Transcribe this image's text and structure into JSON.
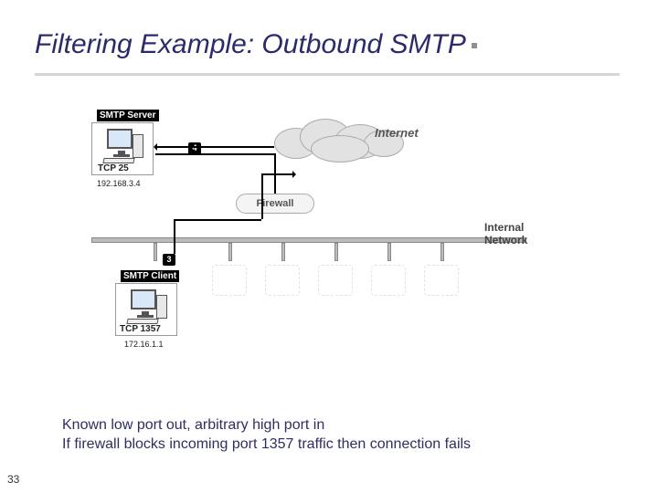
{
  "title": "Filtering Example: Outbound SMTP",
  "slide_number": "33",
  "caption_line1": "Known low port out, arbitrary high port in",
  "caption_line2": "If firewall blocks incoming port 1357 traffic then connection fails",
  "diagram": {
    "server": {
      "tag": "SMTP Server",
      "port": "TCP 25",
      "ip": "192.168.3.4"
    },
    "client": {
      "tag": "SMTP Client",
      "port": "TCP 1357",
      "ip": "172.16.1.1"
    },
    "internet": "Internet",
    "firewall": "Firewall",
    "internal_network": "Internal Network",
    "step_out": "3",
    "step_in": "4"
  }
}
